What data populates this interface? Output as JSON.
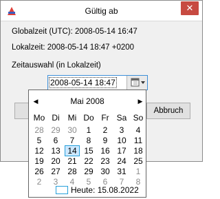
{
  "window": {
    "title": "Gültig ab",
    "close_symbol": "✕"
  },
  "info": {
    "global_time": "Globalzeit (UTC): 2008-05-14 16:47",
    "local_time": "Lokalzeit: 2008-05-14 18:47 +0200",
    "selection_label": "Zeitauswahl (in Lokalzeit)"
  },
  "datetime_field": {
    "value": "2008-05-14 18:47"
  },
  "buttons": {
    "cancel_label": "Abbruch"
  },
  "calendar": {
    "prev_symbol": "◀",
    "next_symbol": "▶",
    "month_title": "Mai 2008",
    "weekdays": [
      "Mo",
      "Di",
      "Mi",
      "Do",
      "Fr",
      "Sa",
      "So"
    ],
    "weeks": [
      [
        "28",
        "29",
        "30",
        "1",
        "2",
        "3",
        "4"
      ],
      [
        "5",
        "6",
        "7",
        "8",
        "9",
        "10",
        "11"
      ],
      [
        "12",
        "13",
        "14",
        "15",
        "16",
        "17",
        "18"
      ],
      [
        "19",
        "20",
        "21",
        "22",
        "23",
        "24",
        "25"
      ],
      [
        "26",
        "27",
        "28",
        "29",
        "30",
        "31",
        "1"
      ],
      [
        "2",
        "3",
        "4",
        "5",
        "6",
        "7",
        "8"
      ]
    ],
    "selected_day": "14",
    "today_label": "Heute: 15.08.2022"
  },
  "colors": {
    "selection_fill": "#cce8ff",
    "selection_border": "#26a0da",
    "close_button": "#c74a41",
    "other_month_text": "#8b8b8b"
  }
}
